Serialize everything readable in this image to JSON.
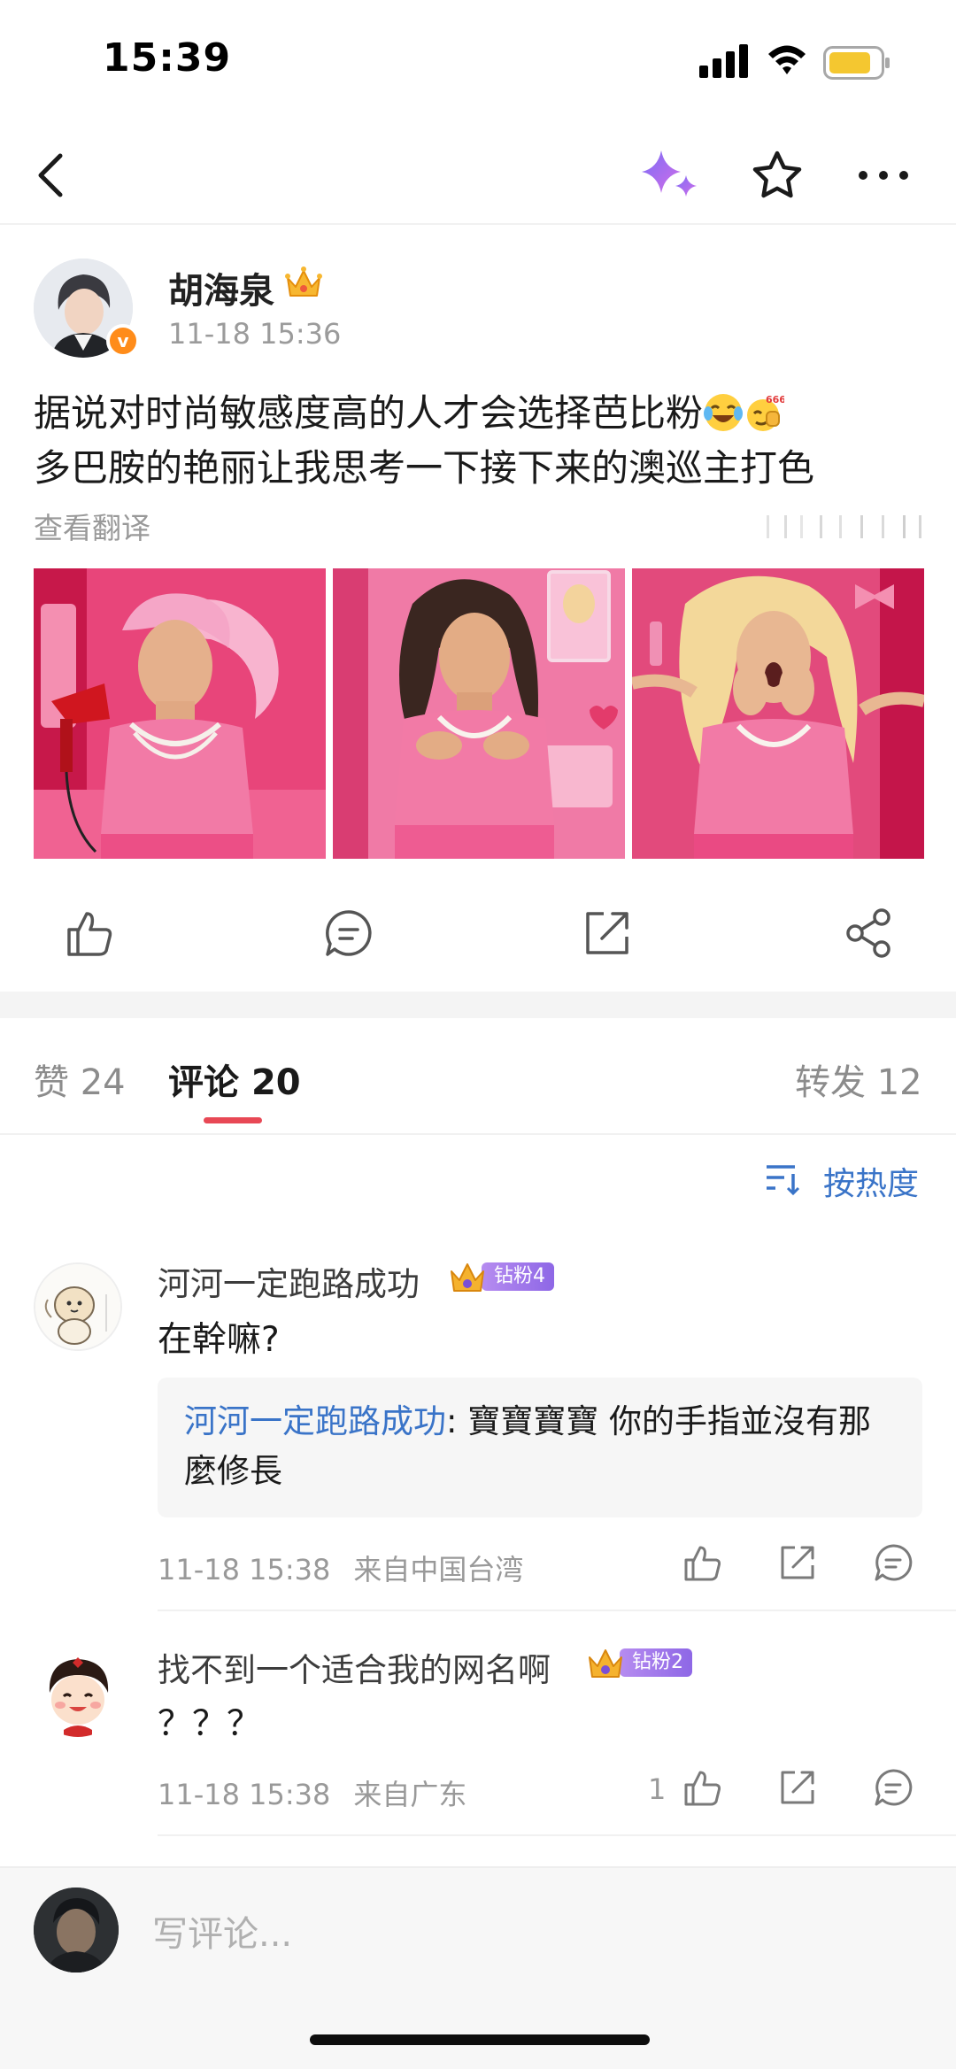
{
  "status_bar": {
    "time": "15:39"
  },
  "post": {
    "author": "胡海泉",
    "time": "11-18 15:36",
    "text_line1": "据说对时尚敏感度高的人才会选择芭比粉",
    "text_line2": "多巴胺的艳丽让我思考一下接下来的澳巡主打色",
    "translate_label": "查看翻译",
    "images": [
      "photo-1",
      "photo-2",
      "photo-3"
    ]
  },
  "tabs": {
    "likes_label": "赞",
    "likes_count": "24",
    "comments_label": "评论",
    "comments_count": "20",
    "reposts_label": "转发",
    "reposts_count": "12"
  },
  "sort": {
    "label": "按热度"
  },
  "comments": [
    {
      "user": "河河一定跑路成功",
      "badge": "钻粉4",
      "text": "在幹嘛?",
      "reply_author": "河河一定跑路成功",
      "reply_text": ": 寶寶寶寶 你的手指並沒有那麼修長",
      "time": "11-18 15:38",
      "location": "来自中国台湾",
      "likes": ""
    },
    {
      "user": "找不到一个适合我的网名啊",
      "badge": "钻粉2",
      "text": "？？？",
      "time": "11-18 15:38",
      "location": "来自广东",
      "likes": "1"
    }
  ],
  "footer": {
    "placeholder": "写评论..."
  },
  "colors": {
    "accent_red": "#e84855",
    "link_blue": "#3a74c8",
    "fan_purple": "#9a74ea"
  }
}
